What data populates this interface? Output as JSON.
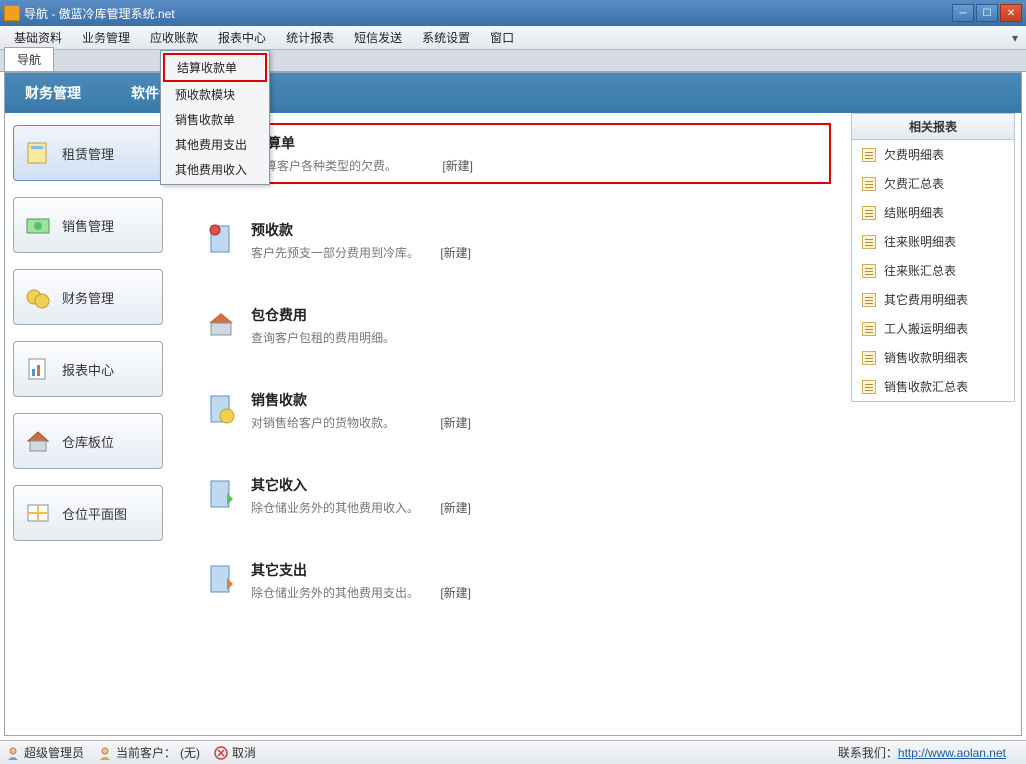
{
  "titlebar": {
    "title": "导航 - 傲蓝冷库管理系统.net"
  },
  "menubar": {
    "items": [
      "基础资料",
      "业务管理",
      "应收账款",
      "报表中心",
      "统计报表",
      "短信发送",
      "系统设置",
      "窗口"
    ]
  },
  "tab": {
    "label": "导航"
  },
  "header": {
    "section_title": "财务管理",
    "version_suffix": "软件试用版本 v5.2"
  },
  "dropdown": {
    "items": [
      "结算收款单",
      "预收款模块",
      "销售收款单",
      "其他费用支出",
      "其他费用收入"
    ]
  },
  "sidebar": {
    "items": [
      {
        "label": "租赁管理",
        "icon": "lease-icon"
      },
      {
        "label": "销售管理",
        "icon": "sales-icon"
      },
      {
        "label": "财务管理",
        "icon": "finance-icon"
      },
      {
        "label": "报表中心",
        "icon": "report-center-icon"
      },
      {
        "label": "仓库板位",
        "icon": "warehouse-icon"
      },
      {
        "label": "仓位平面图",
        "icon": "floorplan-icon"
      }
    ]
  },
  "cards": [
    {
      "title": "结算单",
      "desc": "结算客户各种类型的欠费。",
      "new": "[新建]",
      "highlight": true
    },
    {
      "title": "预收款",
      "desc": "客户先预支一部分费用到冷库。",
      "new": "[新建]",
      "highlight": false
    },
    {
      "title": "包仓费用",
      "desc": "查询客户包租的费用明细。",
      "new": "",
      "highlight": false
    },
    {
      "title": "销售收款",
      "desc": "对销售给客户的货物收款。",
      "new": "[新建]",
      "highlight": false
    },
    {
      "title": "其它收入",
      "desc": "除仓储业务外的其他费用收入。",
      "new": "[新建]",
      "highlight": false
    },
    {
      "title": "其它支出",
      "desc": "除仓储业务外的其他费用支出。",
      "new": "[新建]",
      "highlight": false
    }
  ],
  "reports": {
    "title": "相关报表",
    "items": [
      "欠费明细表",
      "欠费汇总表",
      "结账明细表",
      "往来账明细表",
      "往来账汇总表",
      "其它费用明细表",
      "工人搬运明细表",
      "销售收款明细表",
      "销售收款汇总表"
    ]
  },
  "statusbar": {
    "user": "超级管理员",
    "customer_label": "当前客户：",
    "customer_value": "(无)",
    "cancel": "取消",
    "contact_label": "联系我们：",
    "contact_url": "http://www.aolan.net"
  }
}
